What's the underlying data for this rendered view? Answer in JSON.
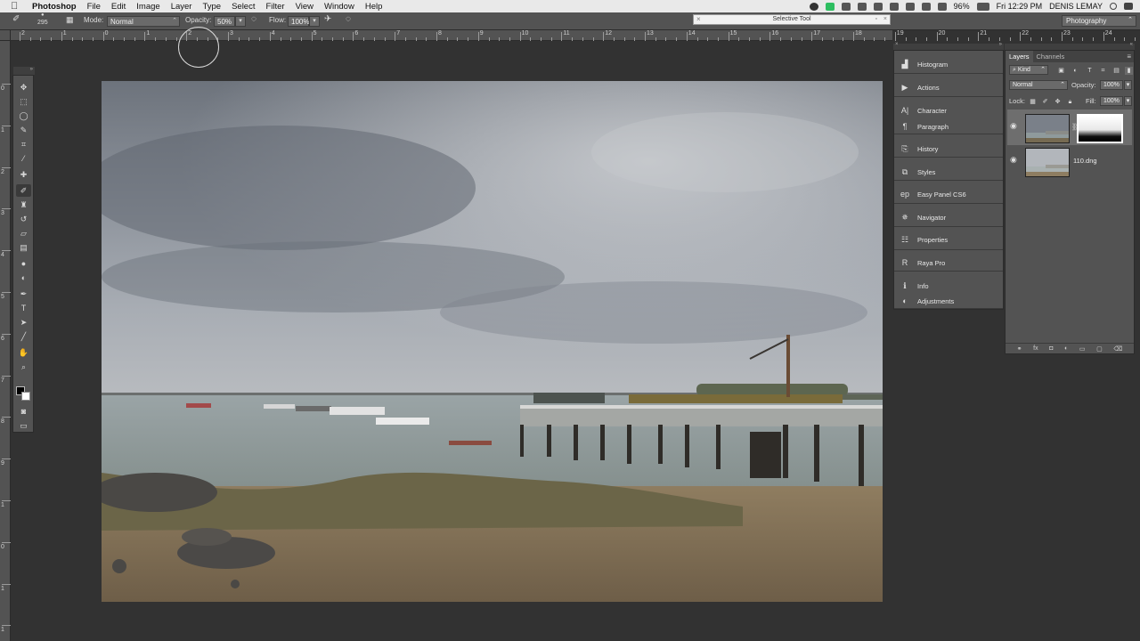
{
  "menubar": {
    "apple": "",
    "app": "Photoshop",
    "items": [
      "File",
      "Edit",
      "Image",
      "Layer",
      "Type",
      "Select",
      "Filter",
      "View",
      "Window",
      "Help"
    ],
    "battery": "96%",
    "clock": "Fri 12:29 PM",
    "user": "DENIS LEMAY"
  },
  "options": {
    "brush_size": "295",
    "mode_label": "Mode:",
    "mode_value": "Normal",
    "opacity_label": "Opacity:",
    "opacity_value": "50%",
    "flow_label": "Flow:",
    "flow_value": "100%"
  },
  "selective_tool": {
    "title": "Selective Tool"
  },
  "workspace": {
    "value": "Photography"
  },
  "ruler_top": [
    "2",
    "1",
    "0",
    "1",
    "2",
    "3",
    "4",
    "5",
    "6",
    "7",
    "8",
    "9",
    "10",
    "11",
    "12",
    "13",
    "14",
    "15",
    "16",
    "17",
    "18",
    "19",
    "20",
    "21",
    "22",
    "23",
    "24"
  ],
  "ruler_left": [
    "0",
    "1",
    "2",
    "3",
    "4",
    "5",
    "6",
    "7",
    "8",
    "9",
    "1",
    "0",
    "1",
    "1",
    "1",
    "2"
  ],
  "tools": [
    {
      "icon": "move-icon",
      "glyph": "✥"
    },
    {
      "icon": "marquee-icon",
      "glyph": "⬚"
    },
    {
      "icon": "lasso-icon",
      "glyph": "◯"
    },
    {
      "icon": "quick-select-icon",
      "glyph": "✎"
    },
    {
      "icon": "crop-icon",
      "glyph": "⌗"
    },
    {
      "icon": "eyedropper-icon",
      "glyph": "⁄"
    },
    {
      "icon": "healing-icon",
      "glyph": "✚"
    },
    {
      "icon": "brush-icon",
      "glyph": "✐"
    },
    {
      "icon": "stamp-icon",
      "glyph": "♜"
    },
    {
      "icon": "history-brush-icon",
      "glyph": "↺"
    },
    {
      "icon": "eraser-icon",
      "glyph": "▱"
    },
    {
      "icon": "gradient-icon",
      "glyph": "▤"
    },
    {
      "icon": "blur-icon",
      "glyph": "●"
    },
    {
      "icon": "dodge-icon",
      "glyph": "◐"
    },
    {
      "icon": "pen-icon",
      "glyph": "✒"
    },
    {
      "icon": "type-icon",
      "glyph": "T"
    },
    {
      "icon": "path-select-icon",
      "glyph": "➤"
    },
    {
      "icon": "line-icon",
      "glyph": "╱"
    },
    {
      "icon": "hand-icon",
      "glyph": "✋"
    },
    {
      "icon": "zoom-icon",
      "glyph": "⌕"
    }
  ],
  "dock": [
    {
      "label": "Histogram",
      "icon": "histogram-icon",
      "glyph": "▟"
    },
    {
      "label": "Actions",
      "icon": "actions-icon",
      "glyph": "▶"
    },
    {
      "label": "Character",
      "icon": "character-icon",
      "glyph": "A|"
    },
    {
      "label": "Paragraph",
      "icon": "paragraph-icon",
      "glyph": "¶"
    },
    {
      "label": "History",
      "icon": "history-icon",
      "glyph": "⎘"
    },
    {
      "label": "Styles",
      "icon": "styles-icon",
      "glyph": "⧉"
    },
    {
      "label": "Easy Panel CS6",
      "icon": "easy-panel-icon",
      "glyph": "ep"
    },
    {
      "label": "Navigator",
      "icon": "navigator-icon",
      "glyph": "✵"
    },
    {
      "label": "Properties",
      "icon": "properties-icon",
      "glyph": "☷"
    },
    {
      "label": "Raya Pro",
      "icon": "raya-pro-icon",
      "glyph": "R"
    },
    {
      "label": "Info",
      "icon": "info-icon",
      "glyph": "ℹ"
    },
    {
      "label": "Adjustments",
      "icon": "adjustments-icon",
      "glyph": "◐"
    }
  ],
  "layers_panel": {
    "tabs": [
      "Layers",
      "Channels"
    ],
    "kind": "Kind",
    "blend": "Normal",
    "opacity_label": "Opacity:",
    "opacity": "100%",
    "lock_label": "Lock:",
    "fill_label": "Fill:",
    "fill": "100%",
    "layers": [
      {
        "name": "",
        "has_mask": true,
        "selected": true
      },
      {
        "name": "110.dng",
        "has_mask": false,
        "selected": false
      }
    ],
    "bottom_icons": [
      "link-icon",
      "fx-icon",
      "mask-icon",
      "adjustment-icon",
      "group-icon",
      "new-layer-icon",
      "trash-icon"
    ],
    "fx": "fx"
  }
}
